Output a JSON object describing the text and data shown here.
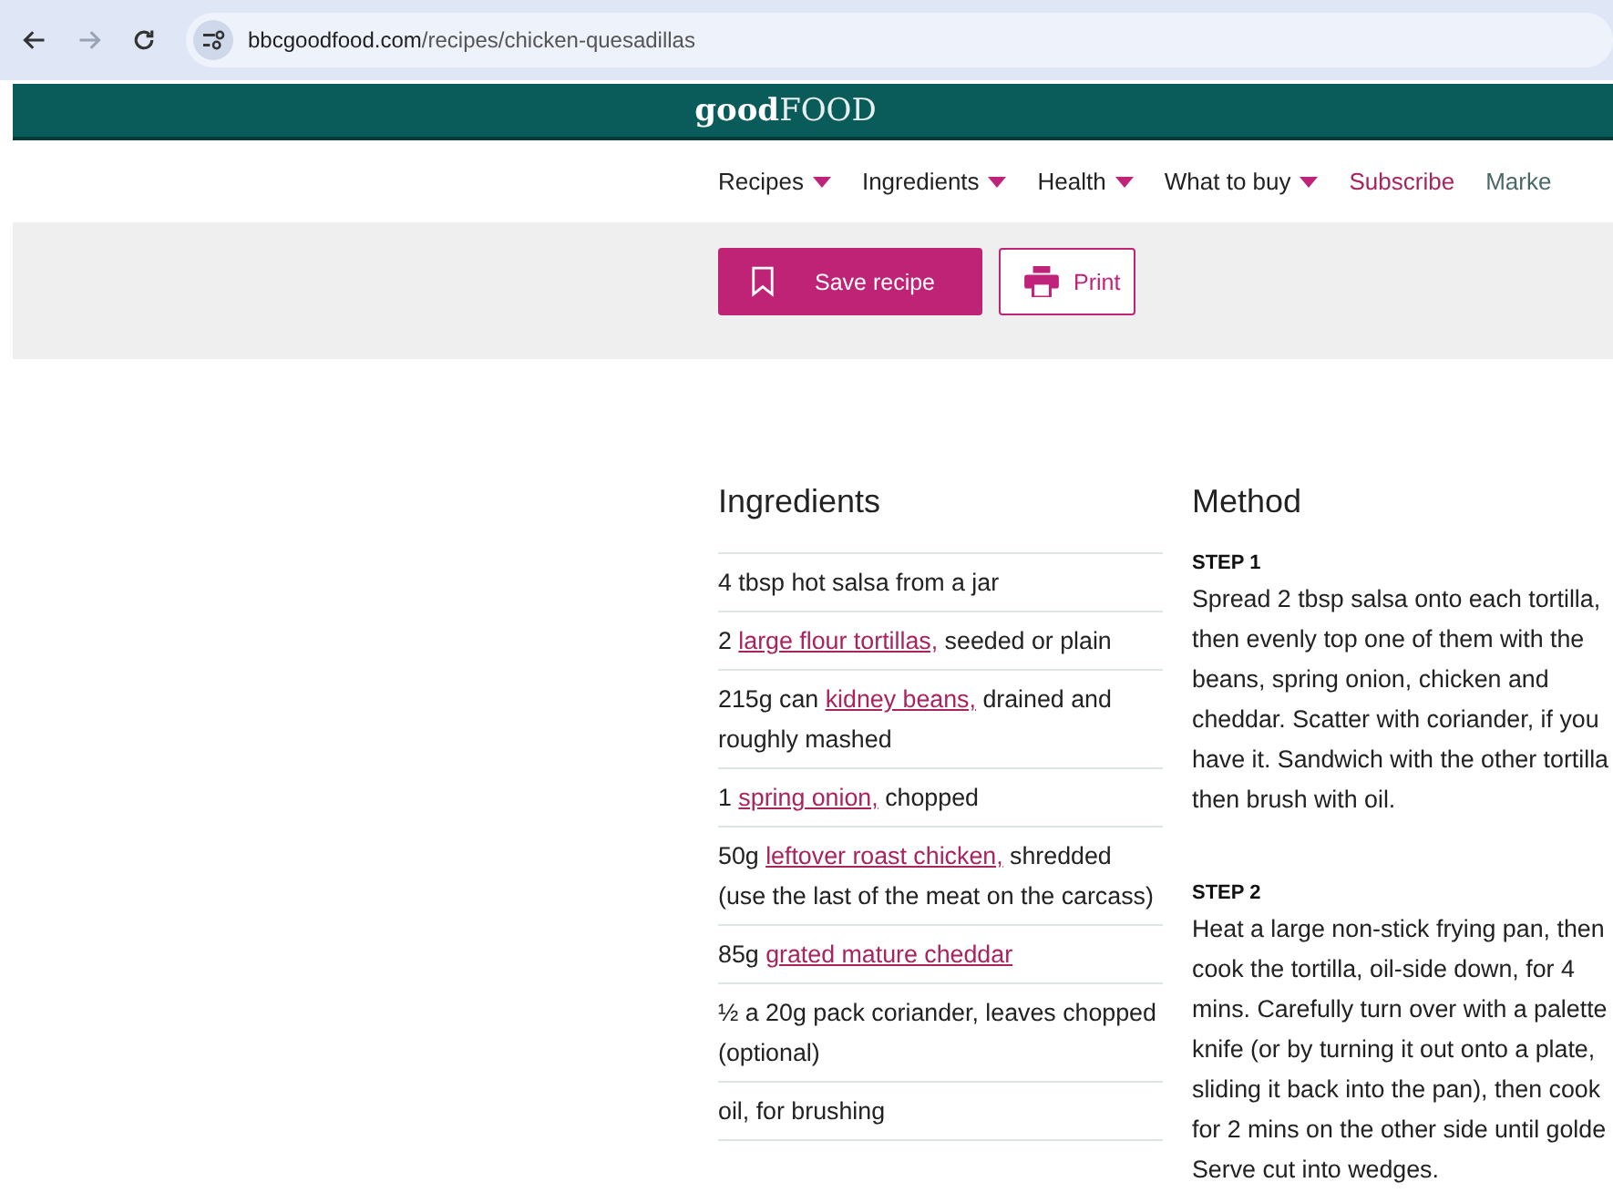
{
  "browser": {
    "url_domain": "bbcgoodfood.com",
    "url_path": "/recipes/chicken-quesadillas"
  },
  "logo": {
    "bold": "good",
    "light": "FOOD"
  },
  "nav": [
    {
      "label": "Recipes",
      "kind": "menu"
    },
    {
      "label": "Ingredients",
      "kind": "menu"
    },
    {
      "label": "Health",
      "kind": "menu"
    },
    {
      "label": "What to buy",
      "kind": "menu"
    },
    {
      "label": "Subscribe",
      "kind": "accent"
    },
    {
      "label": "Marke",
      "kind": "plain"
    }
  ],
  "actions": {
    "save": "Save recipe",
    "print": "Print"
  },
  "ingredients": {
    "title": "Ingredients",
    "items": [
      {
        "parts": [
          {
            "text": "4 tbsp hot salsa from a jar",
            "link": false
          }
        ]
      },
      {
        "parts": [
          {
            "text": "2 ",
            "link": false
          },
          {
            "text": "large flour tortillas,",
            "link": true
          },
          {
            "text": " seeded or plain",
            "link": false
          }
        ]
      },
      {
        "parts": [
          {
            "text": "215g can ",
            "link": false
          },
          {
            "text": "kidney beans,",
            "link": true
          },
          {
            "text": " drained and roughly mashed",
            "link": false
          }
        ]
      },
      {
        "parts": [
          {
            "text": "1 ",
            "link": false
          },
          {
            "text": "spring onion,",
            "link": true
          },
          {
            "text": " chopped",
            "link": false
          }
        ]
      },
      {
        "parts": [
          {
            "text": "50g ",
            "link": false
          },
          {
            "text": "leftover roast chicken,",
            "link": true
          },
          {
            "text": " shredded (use the last of the meat on the carcass)",
            "link": false
          }
        ]
      },
      {
        "parts": [
          {
            "text": "85g ",
            "link": false
          },
          {
            "text": "grated mature cheddar",
            "link": true
          }
        ]
      },
      {
        "parts": [
          {
            "text": "½ a 20g pack coriander, leaves chopped (optional)",
            "link": false
          }
        ]
      },
      {
        "parts": [
          {
            "text": "oil, for brushing",
            "link": false
          }
        ]
      }
    ]
  },
  "method": {
    "title": "Method",
    "steps": [
      {
        "label": "STEP 1",
        "lines": [
          "Spread 2 tbsp salsa onto each tortilla,",
          "then evenly top one of them with the",
          "beans, spring onion, chicken and",
          "cheddar. Scatter with coriander, if you",
          "have it. Sandwich with the other tortilla",
          "then brush with oil."
        ]
      },
      {
        "label": "STEP 2",
        "lines": [
          "Heat a large non-stick frying pan, then",
          "cook the tortilla, oil-side down, for 4",
          "mins. Carefully turn over with a palette",
          "knife (or by turning it out onto a plate,",
          "sliding it back into the pan), then cook",
          "for 2 mins on the other side until golde",
          "Serve cut into wedges."
        ]
      }
    ]
  }
}
